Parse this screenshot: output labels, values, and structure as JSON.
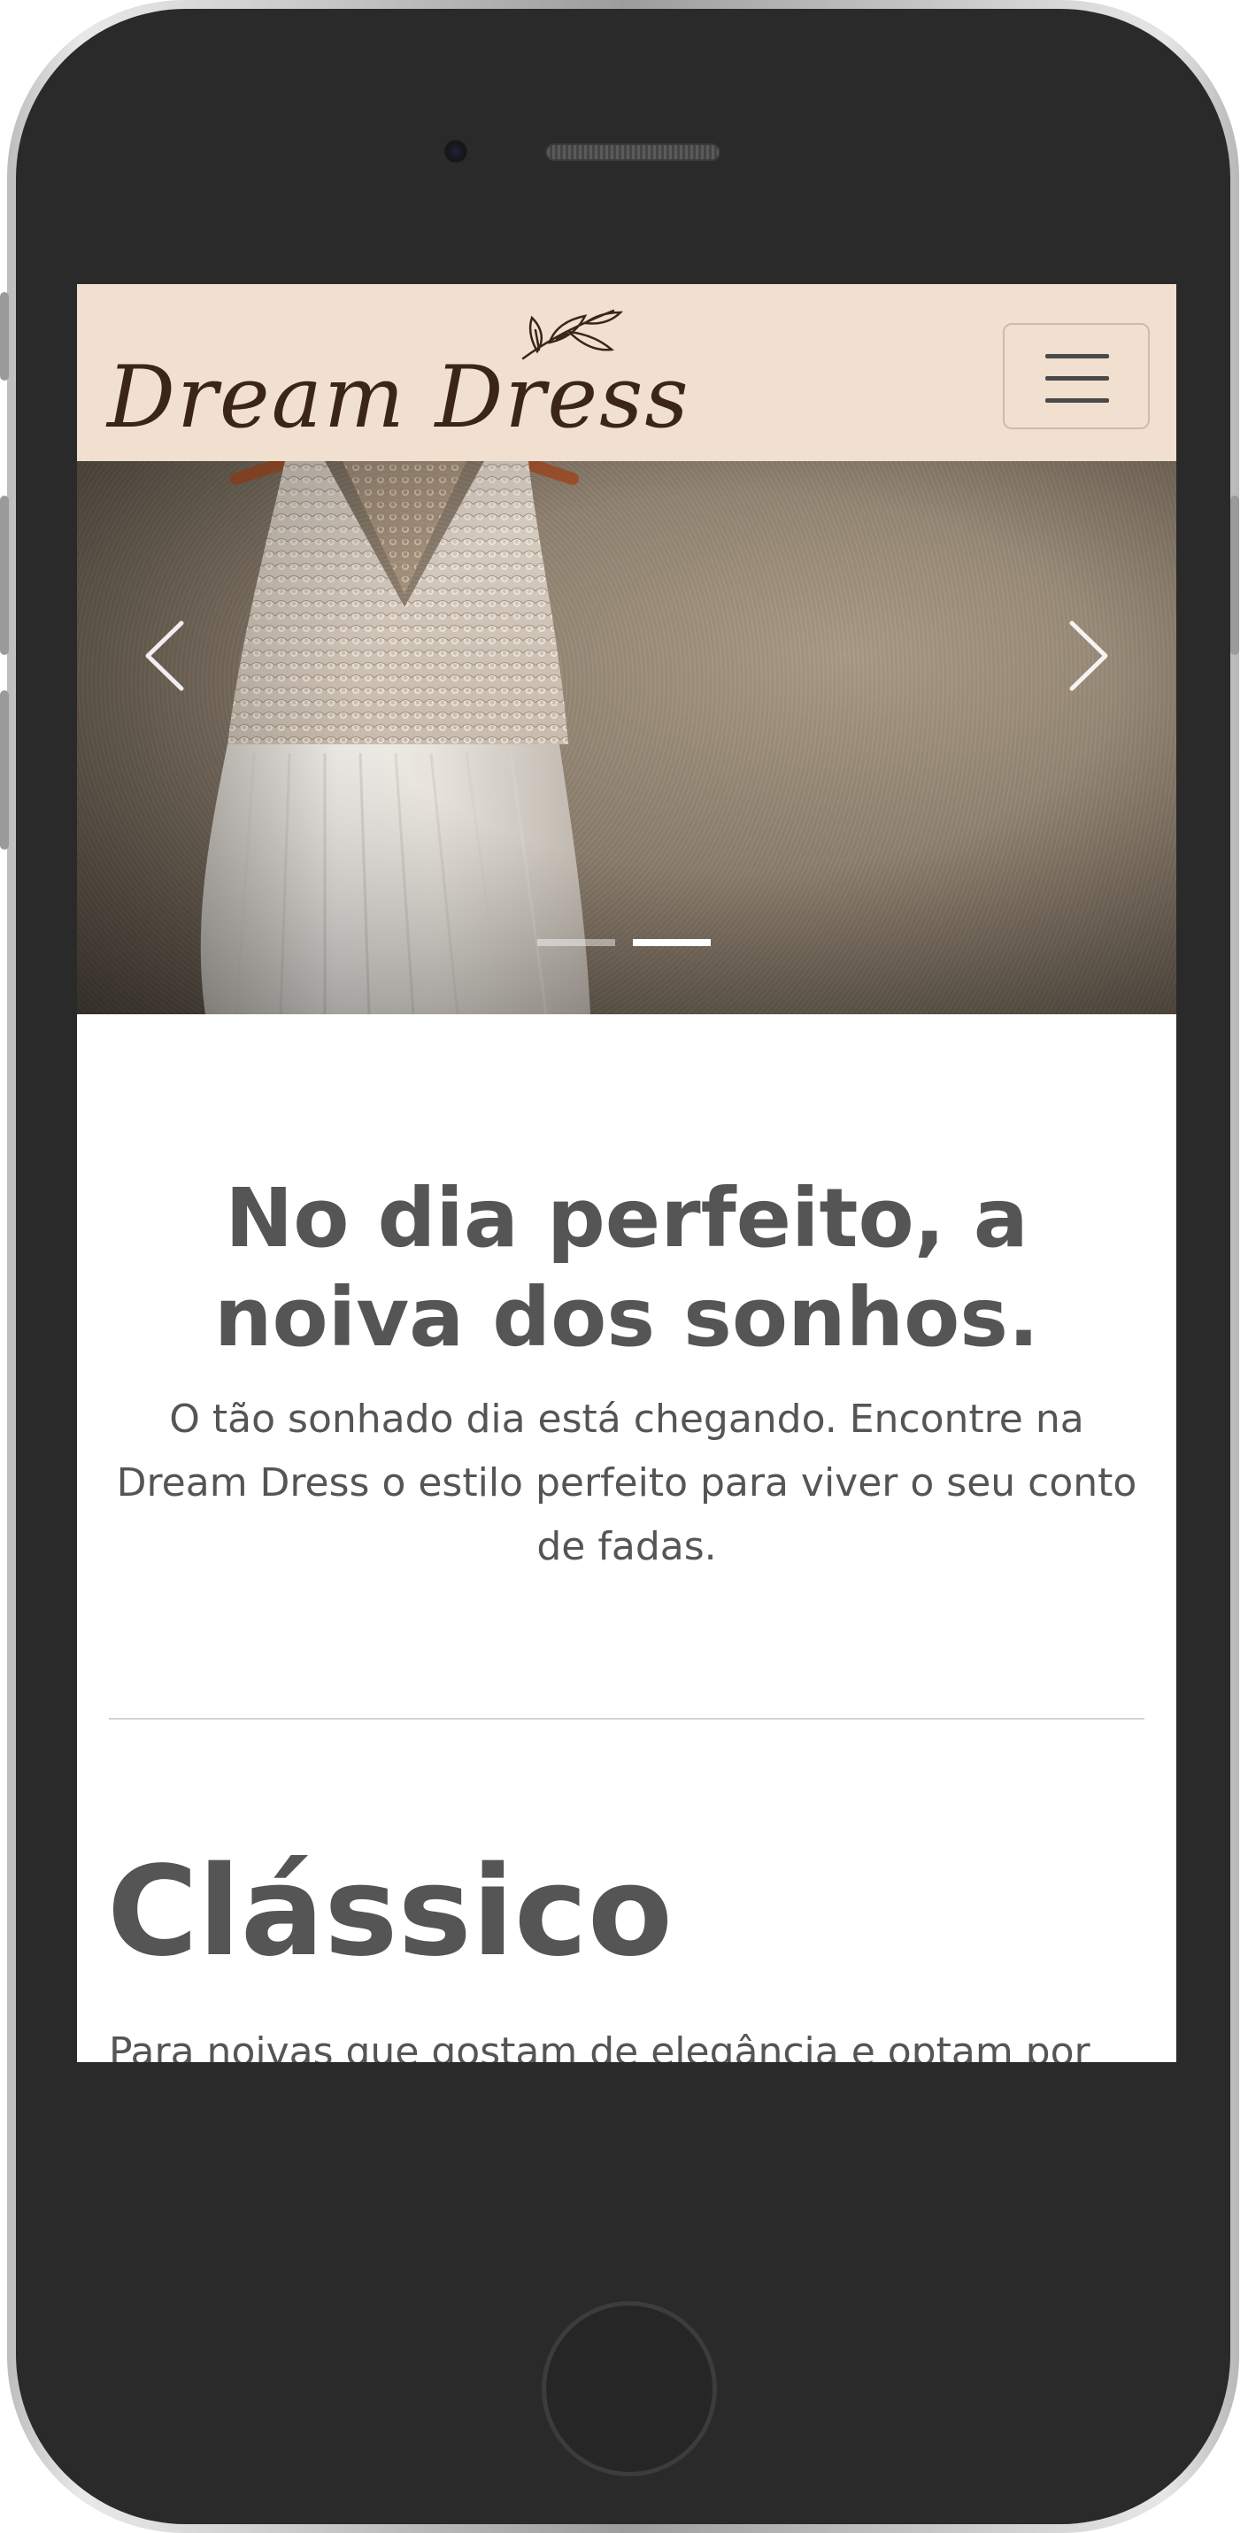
{
  "brand": {
    "logo_text": "Dream Dress",
    "colors": {
      "navbar_bg": "#f1dfcf",
      "logo_ink": "#3b2519",
      "text": "#555555"
    }
  },
  "navbar": {
    "menu_icon": "hamburger-icon"
  },
  "carousel": {
    "prev_icon": "chevron-left-icon",
    "next_icon": "chevron-right-icon",
    "slide_count": 2,
    "active_slide": 2
  },
  "hero": {
    "headline": "No dia perfeito, a noiva dos sonhos.",
    "text": "O tão sonhado dia está chegando. Encontre na Dream Dress o estilo perfeito para viver o seu conto de fadas."
  },
  "style_section": {
    "title": "Clássico",
    "text": "Para noivas que gostam de elegância e optam por um estilo tradicional. Os vestidos deste estilo possuem modelagem tradicional, geralmente com corte evasê, feitos com tecidos nobres e"
  }
}
